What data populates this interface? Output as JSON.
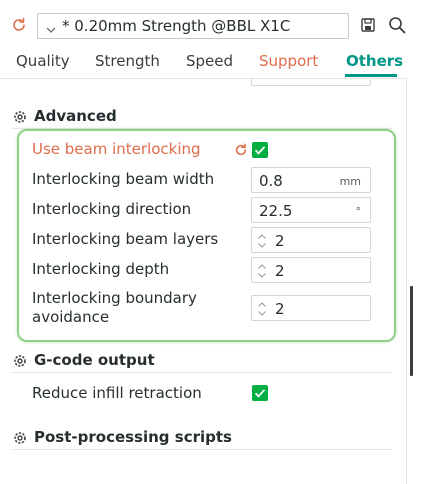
{
  "header": {
    "preset_name": "* 0.20mm Strength @BBL X1C"
  },
  "tabs": [
    {
      "label": "Quality",
      "state": "normal"
    },
    {
      "label": "Strength",
      "state": "normal"
    },
    {
      "label": "Speed",
      "state": "normal"
    },
    {
      "label": "Support",
      "state": "modified"
    },
    {
      "label": "Others",
      "state": "active"
    }
  ],
  "colors": {
    "accent": "#009688",
    "modified": "#e06c4b",
    "checkbox": "#00ae42",
    "highlight": "#8fcf8a"
  },
  "sections": {
    "advanced": {
      "title": "Advanced",
      "fields": {
        "use_beam_interlocking": {
          "label": "Use beam interlocking",
          "checked": true,
          "modified": true
        },
        "beam_width": {
          "label": "Interlocking beam width",
          "value": "0.8",
          "unit": "mm"
        },
        "direction": {
          "label": "Interlocking direction",
          "value": "22.5",
          "unit": "°"
        },
        "beam_layers": {
          "label": "Interlocking beam layers",
          "value": "2"
        },
        "depth": {
          "label": "Interlocking depth",
          "value": "2"
        },
        "boundary_avoidance": {
          "label": "Interlocking boundary avoidance",
          "value": "2"
        }
      }
    },
    "gcode_output": {
      "title": "G-code output",
      "fields": {
        "reduce_infill_retraction": {
          "label": "Reduce infill retraction",
          "checked": true
        }
      }
    },
    "post_processing": {
      "title": "Post-processing scripts"
    }
  }
}
